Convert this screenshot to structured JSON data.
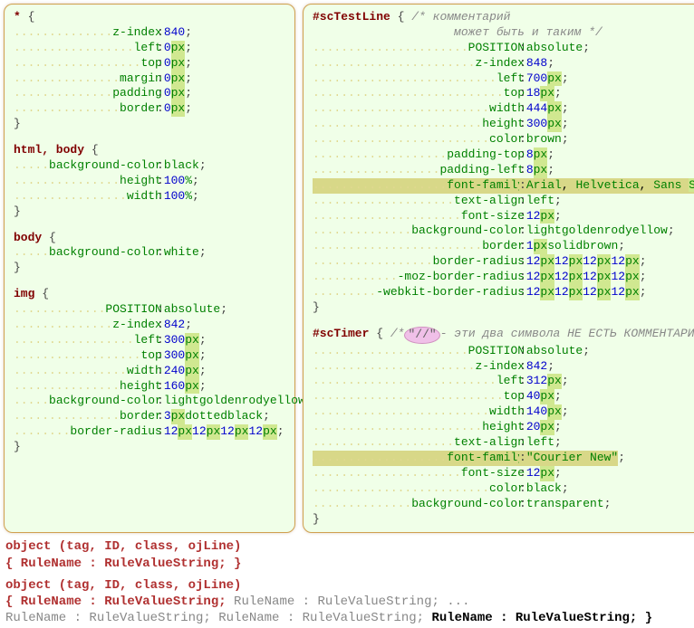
{
  "left": {
    "block1": {
      "selector": "*",
      "rules": [
        {
          "prop": "z-index",
          "val": "840",
          "px": false
        },
        {
          "prop": "left",
          "val": "0",
          "px": true
        },
        {
          "prop": "top",
          "val": "0",
          "px": true
        },
        {
          "prop": "margin",
          "val": "0",
          "px": true
        },
        {
          "prop": "padding",
          "val": "0",
          "px": true
        },
        {
          "prop": "border",
          "val": "0",
          "px": true
        }
      ]
    },
    "block2": {
      "selector": "html, body",
      "rules": [
        {
          "prop": "background-color",
          "val": "black",
          "kw": true
        },
        {
          "prop": "height",
          "val": "100",
          "unit": "%"
        },
        {
          "prop": "width",
          "val": "100",
          "unit": "%"
        }
      ]
    },
    "block3": {
      "selector": "body",
      "rules": [
        {
          "prop": "background-color",
          "val": "white",
          "kw": true
        }
      ]
    },
    "block4": {
      "selector": "img",
      "rules": [
        {
          "prop": "POSITION",
          "val": "absolute",
          "kw": true
        },
        {
          "prop": "z-index",
          "val": "842",
          "px": false
        },
        {
          "prop": "left",
          "val": "300",
          "px": true
        },
        {
          "prop": "top",
          "val": "300",
          "px": true
        },
        {
          "prop": "width",
          "val": "240",
          "px": true
        },
        {
          "prop": "height",
          "val": "160",
          "px": true
        },
        {
          "prop": "background-color",
          "val": "lightgoldenrodyellow",
          "kw": true
        },
        {
          "prop": "border",
          "val_raw": [
            {
              "t": "3",
              "num": true
            },
            {
              "t": "px",
              "bg": true
            },
            {
              "t": " "
            },
            {
              "t": "dotted",
              "kw": true
            },
            {
              "t": " "
            },
            {
              "t": "black",
              "kw": true
            }
          ]
        },
        {
          "prop": "border-radius",
          "val_raw": [
            {
              "t": "12",
              "num": true
            },
            {
              "t": "px",
              "bg": true
            },
            {
              "t": " "
            },
            {
              "t": "12",
              "num": true
            },
            {
              "t": "px",
              "bg": true
            },
            {
              "t": " "
            },
            {
              "t": "12",
              "num": true
            },
            {
              "t": "px",
              "bg": true
            },
            {
              "t": " "
            },
            {
              "t": "12",
              "num": true
            },
            {
              "t": "px",
              "bg": true
            }
          ]
        }
      ]
    }
  },
  "right": {
    "block1": {
      "selector": "#scTestLine",
      "comment1": "/* комментарий",
      "comment2": "может быть и таким */",
      "rules": [
        {
          "prop": "POSITION",
          "val": "absolute",
          "kw": true
        },
        {
          "prop": "z-index",
          "val": "848",
          "px": false
        },
        {
          "prop": "left",
          "val": "700",
          "px": true
        },
        {
          "prop": "top",
          "val": "18",
          "px": true
        },
        {
          "prop": "width",
          "val": "444",
          "px": true
        },
        {
          "prop": "height",
          "val": "300",
          "px": true
        },
        {
          "prop": "color",
          "val": "brown",
          "kw": true
        },
        {
          "prop": "padding-top",
          "val": "8",
          "px": true
        },
        {
          "prop": "padding-left",
          "val": "8",
          "px": true
        },
        {
          "prop": "font-family",
          "val_raw": [
            {
              "t": "Arial",
              "kw": true
            },
            {
              "t": ", "
            },
            {
              "t": "Helvetica",
              "kw": true
            },
            {
              "t": ", "
            },
            {
              "t": "Sans",
              "kw": true
            },
            {
              "t": " "
            },
            {
              "t": "Serif",
              "kw": true,
              "bg": true
            }
          ],
          "hl": true
        },
        {
          "prop": "text-align",
          "val": "left",
          "kw": true
        },
        {
          "prop": "font-size",
          "val": "12",
          "px": true
        },
        {
          "prop": "background-color",
          "val": "lightgoldenrodyellow",
          "kw": true
        },
        {
          "prop": "border",
          "val_raw": [
            {
              "t": "1",
              "num": true
            },
            {
              "t": "px",
              "bg": true
            },
            {
              "t": " "
            },
            {
              "t": "solid",
              "kw": true
            },
            {
              "t": " "
            },
            {
              "t": "brown",
              "kw": true
            }
          ]
        },
        {
          "prop": "border-radius",
          "val_raw": [
            {
              "t": "12",
              "num": true
            },
            {
              "t": "px",
              "bg": true
            },
            {
              "t": " "
            },
            {
              "t": "12",
              "num": true
            },
            {
              "t": "px",
              "bg": true
            },
            {
              "t": " "
            },
            {
              "t": "12",
              "num": true
            },
            {
              "t": "px",
              "bg": true
            },
            {
              "t": " "
            },
            {
              "t": "12",
              "num": true
            },
            {
              "t": "px",
              "bg": true
            }
          ]
        },
        {
          "prop": "-moz-border-radius",
          "val_raw": [
            {
              "t": "12",
              "num": true
            },
            {
              "t": "px",
              "bg": true
            },
            {
              "t": " "
            },
            {
              "t": "12",
              "num": true
            },
            {
              "t": "px",
              "bg": true
            },
            {
              "t": " "
            },
            {
              "t": "12",
              "num": true
            },
            {
              "t": "px",
              "bg": true
            },
            {
              "t": " "
            },
            {
              "t": "12",
              "num": true
            },
            {
              "t": "px",
              "bg": true
            }
          ]
        },
        {
          "prop": "-webkit-border-radius",
          "val_raw": [
            {
              "t": "12",
              "num": true
            },
            {
              "t": "px",
              "bg": true
            },
            {
              "t": " "
            },
            {
              "t": "12",
              "num": true
            },
            {
              "t": "px",
              "bg": true
            },
            {
              "t": " "
            },
            {
              "t": "12",
              "num": true
            },
            {
              "t": "px",
              "bg": true
            },
            {
              "t": " "
            },
            {
              "t": "12",
              "num": true
            },
            {
              "t": "px",
              "bg": true
            }
          ]
        }
      ]
    },
    "block2": {
      "selector": "#scTimer",
      "comment_badge": "\"//\"",
      "comment_rest": " - эти два символа НЕ ЕСТЬ КОММЕНТАРИЙ */",
      "comment_pre": "/* ",
      "rules": [
        {
          "prop": "POSITION",
          "val": "absolute",
          "kw": true
        },
        {
          "prop": "z-index",
          "val": "842",
          "px": false
        },
        {
          "prop": "left",
          "val": "312",
          "px": true
        },
        {
          "prop": "top",
          "val": "40",
          "px": true
        },
        {
          "prop": "width",
          "val": "140",
          "px": true
        },
        {
          "prop": "height",
          "val": "20",
          "px": true
        },
        {
          "prop": "text-align",
          "val": "left",
          "kw": true
        },
        {
          "prop": "font-family",
          "val": "\"Courier New\"",
          "kw": true,
          "hl": true
        },
        {
          "prop": "font-size",
          "val": "12",
          "px": true
        },
        {
          "prop": "color",
          "val": "black",
          "kw": true
        },
        {
          "prop": "background-color",
          "val": "transparent",
          "kw": true
        }
      ]
    }
  },
  "bottom": {
    "line1a": "object (tag, ID, class, ojLine)",
    "line1b": "{ RuleName : RuleValueString; }",
    "line2a": "object (tag, ID, class, ojLine)",
    "line2b_parts": [
      {
        "t": "{ RuleName : RuleValueString;",
        "c": "red"
      },
      {
        "t": " RuleName : RuleValueString; ...",
        "c": "gray"
      }
    ],
    "line2c_parts": [
      {
        "t": "RuleName : RuleValueString; RuleName : RuleValueString;",
        "c": "gray"
      },
      {
        "t": " RuleName : RuleValueString; }",
        "c": "black"
      }
    ]
  }
}
